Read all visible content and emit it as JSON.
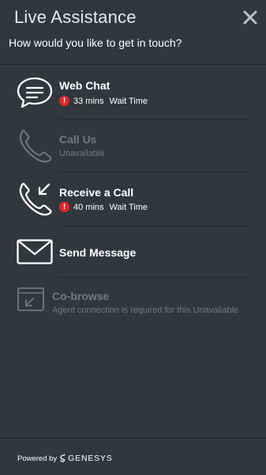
{
  "header": {
    "title": "Live Assistance",
    "subtitle": "How would you like to get in touch?"
  },
  "options": [
    {
      "label": "Web Chat",
      "status_value": "33 mins",
      "status_suffix": "Wait Time",
      "icon": "chat-bubble-icon",
      "enabled": true
    },
    {
      "label": "Call Us",
      "status": "Unavailable",
      "icon": "phone-icon",
      "enabled": false
    },
    {
      "label": "Receive a Call",
      "status_value": "40 mins",
      "status_suffix": "Wait Time",
      "icon": "incoming-call-icon",
      "enabled": true
    },
    {
      "label": "Send Message",
      "icon": "envelope-icon",
      "enabled": true
    },
    {
      "label": "Co-browse",
      "status": "Agent connection is required for this.Unavailable",
      "icon": "cobrowse-icon",
      "enabled": false
    }
  ],
  "footer": {
    "powered_by": "Powered by",
    "brand": "GENESYS"
  },
  "colors": {
    "background": "#33373b",
    "alert": "#e0262b",
    "disabled_text": "#74787c"
  }
}
